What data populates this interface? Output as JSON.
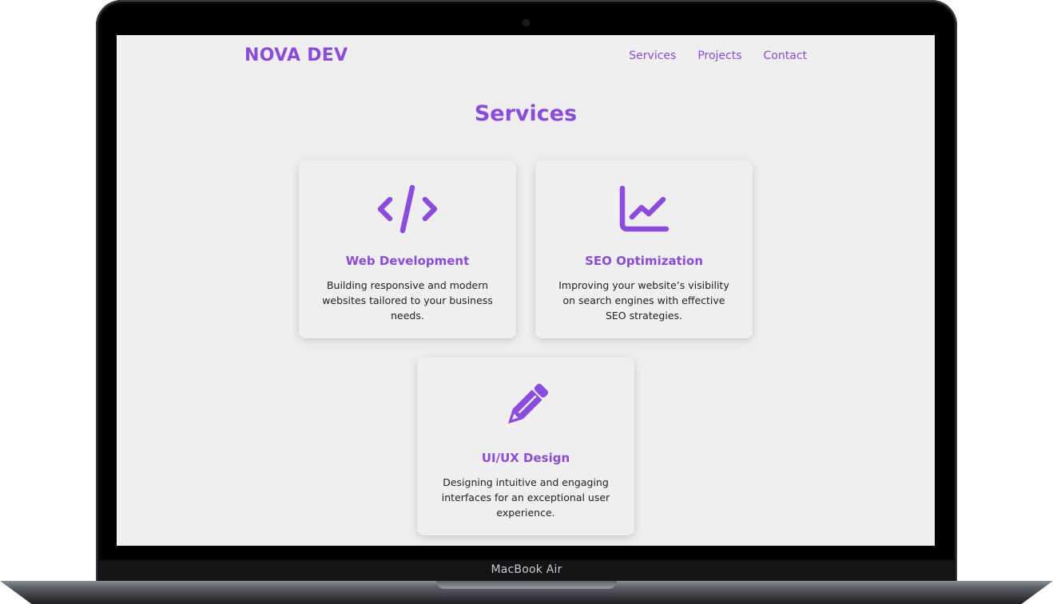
{
  "device": {
    "label": "MacBook Air"
  },
  "header": {
    "logo": "NOVA DEV",
    "nav": [
      {
        "label": "Services"
      },
      {
        "label": "Projects"
      },
      {
        "label": "Contact"
      }
    ]
  },
  "services": {
    "title": "Services",
    "cards": [
      {
        "icon": "code-icon",
        "title": "Web Development",
        "description": "Building responsive and modern websites tailored to your business needs."
      },
      {
        "icon": "line-chart-icon",
        "title": "SEO Optimization",
        "description": "Improving your website’s visibility on search engines with effective SEO strategies."
      },
      {
        "icon": "pencil-icon",
        "title": "UI/UX Design",
        "description": "Designing intuitive and engaging interfaces for an exceptional user experience."
      }
    ]
  },
  "colors": {
    "accent": "#8a4be0",
    "background": "#efeff0",
    "text": "#222222"
  }
}
